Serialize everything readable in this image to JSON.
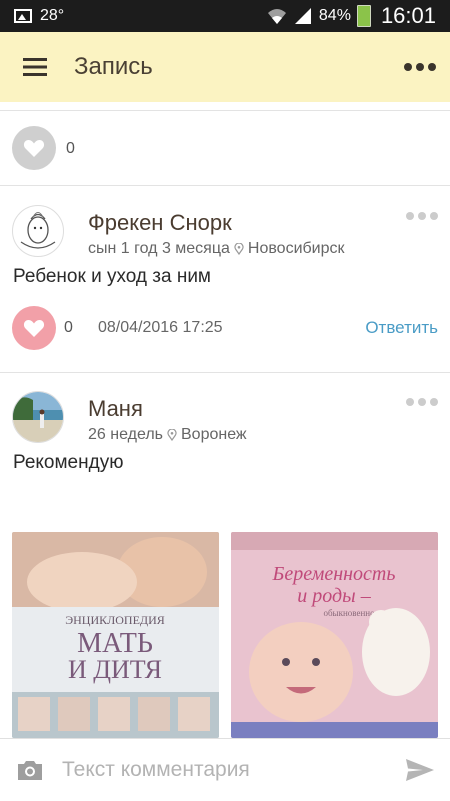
{
  "status_bar": {
    "temperature": "28°",
    "battery": "84%",
    "time": "16:01"
  },
  "app_bar": {
    "title": "Запись",
    "menu_icon": "hamburger-menu-icon",
    "more_icon": "more-dots-icon"
  },
  "top_post": {
    "likes": "0"
  },
  "comments": [
    {
      "author": "Фрекен Снорк",
      "child_age": "сын 1 год 3 месяца",
      "city": "Новосибирск",
      "text": "Ребенок и уход за ним",
      "likes": "0",
      "date": "08/04/2016 17:25",
      "reply_label": "Ответить"
    },
    {
      "author": "Маня",
      "child_age": "26 недель",
      "city": "Воронеж",
      "text": "Рекомендую"
    }
  ],
  "photos": [
    {
      "name": "book-mat-i-ditya-photo",
      "title_lines": [
        "ЭНЦИКЛОПЕДИЯ",
        "МАТЬ",
        "И ДИТЯ"
      ]
    },
    {
      "name": "book-beremennost-photo",
      "title_lines": [
        "Беременность",
        "и роды –",
        "обыкновенное чудо"
      ]
    }
  ],
  "comment_bar": {
    "placeholder": "Текст комментария"
  },
  "colors": {
    "appbar_bg": "#fbf3c2",
    "accent_link": "#4a9cc6",
    "like_active": "#f2a0a8",
    "like_inactive": "#cfcfcf"
  }
}
